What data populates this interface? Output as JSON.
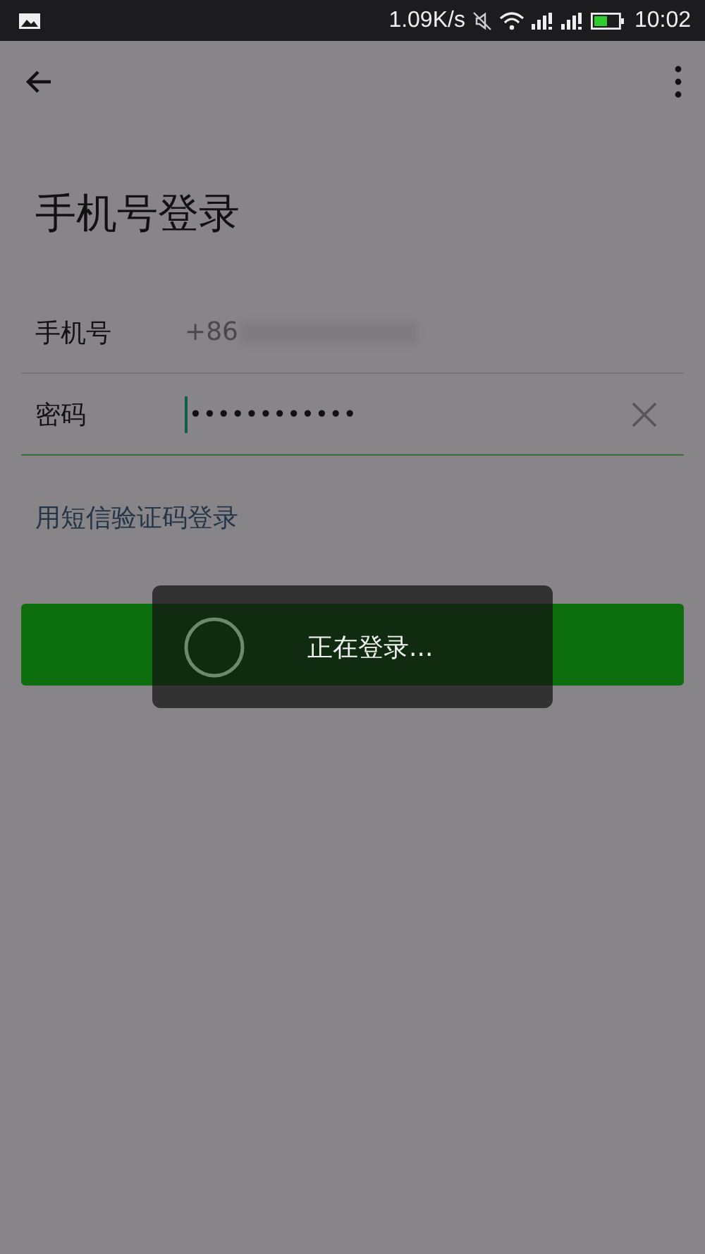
{
  "status_bar": {
    "network_speed": "1.09K/s",
    "time": "10:02"
  },
  "title": "手机号登录",
  "fields": [
    {
      "kind": "phone",
      "label": "手机号",
      "value": "+86",
      "focused": false,
      "clear_button": false
    },
    {
      "kind": "password",
      "label": "密码",
      "value": "••••••••••••",
      "focused": true,
      "clear_button": true
    }
  ],
  "sms_login_link": "用短信验证码登录",
  "loading_dialog": {
    "message": "正在登录..."
  }
}
